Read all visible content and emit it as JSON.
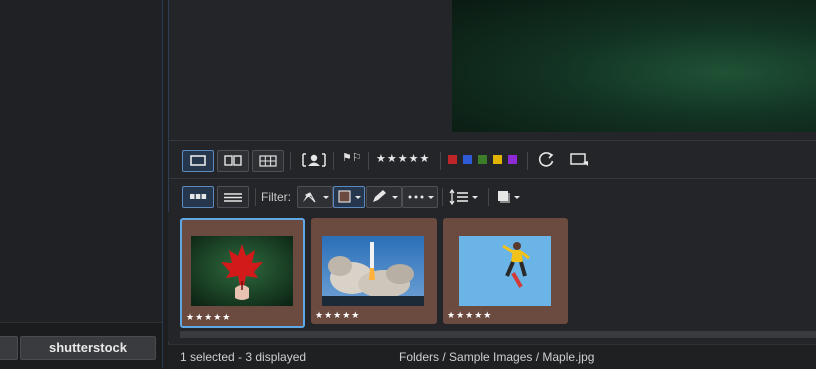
{
  "left": {
    "brand_button_label": "shutterstock",
    "brand_button_mark": "·"
  },
  "toolbar1": {
    "flags_label": "⚑⚐",
    "rating_stars": "★★★★★",
    "color_labels": [
      "#c0252a",
      "#2f5bd6",
      "#3c7d2a",
      "#e0b400",
      "#8e2bd6"
    ]
  },
  "toolbar2": {
    "filter_label": "Filter:"
  },
  "thumbnails": [
    {
      "name": "Maple",
      "stars": "★★★★★",
      "selected": true
    },
    {
      "name": "Rocket launch",
      "stars": "★★★★★",
      "selected": false
    },
    {
      "name": "Skateboarder",
      "stars": "★★★★★",
      "selected": false
    }
  ],
  "status": {
    "selection": "1 selected - 3 displayed",
    "path": "Folders / Sample Images / Maple.jpg"
  },
  "colors": {
    "thumb_bg": "#6b4a3f",
    "selection_border": "#5fa8e8",
    "active_button": "#5a8ac0"
  }
}
